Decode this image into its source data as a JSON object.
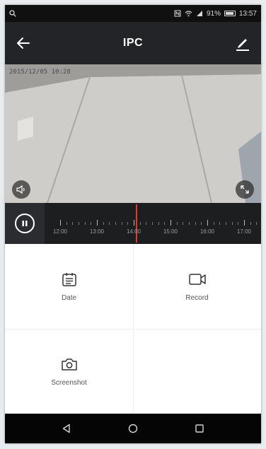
{
  "status_bar": {
    "battery_percent": "91%",
    "time": "13:57"
  },
  "header": {
    "title": "IPC"
  },
  "video": {
    "osd_text": "2015/12/05 10:28"
  },
  "timeline": {
    "labels": [
      "12:00",
      "13:00",
      "14:00",
      "15:00",
      "16:00",
      "17:00"
    ]
  },
  "actions": {
    "date_label": "Date",
    "record_label": "Record",
    "screenshot_label": "Screenshot"
  },
  "colors": {
    "header_bg": "#222427",
    "timeline_cursor": "#e13a2b",
    "navbar_bg": "#050505"
  }
}
